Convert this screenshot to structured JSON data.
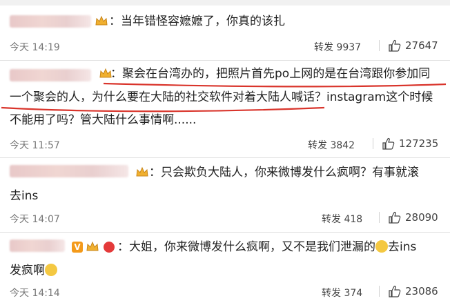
{
  "comments": [
    {
      "text_lines": [
        "：当年错怪容嬷嬷了，你真的该扎"
      ],
      "time": "今天 14:19",
      "repost": "转发 9937",
      "likes": "27647"
    },
    {
      "text_lines": [
        "：聚会在台湾办的，把照片首先po上网的是在台湾跟你参加同",
        "一个聚会的人，为什么要在大陆的社交软件对着大陆人喊话？instagram这个时候",
        "不能用了吗？管大陆什么事情啊......"
      ],
      "time": "今天 11:57",
      "repost": "转发 3842",
      "likes": "127235"
    },
    {
      "text_lines": [
        "：只会欺负大陆人，你来微博发什么疯啊？有事就滚",
        "去ins"
      ],
      "time": "今天 14:07",
      "repost": "转发 418",
      "likes": "28090"
    },
    {
      "text_lines": [
        "：大姐，你来微博发什么疯啊，又不是我们泄漏的",
        "发疯啊"
      ],
      "text_suffix": "去ins",
      "time": "今天 14:14",
      "repost": "转发 374",
      "likes": "23086"
    }
  ],
  "badge_v": "V",
  "colors": {
    "underline": "#d9342b",
    "secondary_text": "#777777",
    "badge": "#f2b23a"
  },
  "icons": {
    "like": "thumbs-up-icon",
    "member": "crown-icon",
    "emoji": "smiley-face-icon"
  }
}
